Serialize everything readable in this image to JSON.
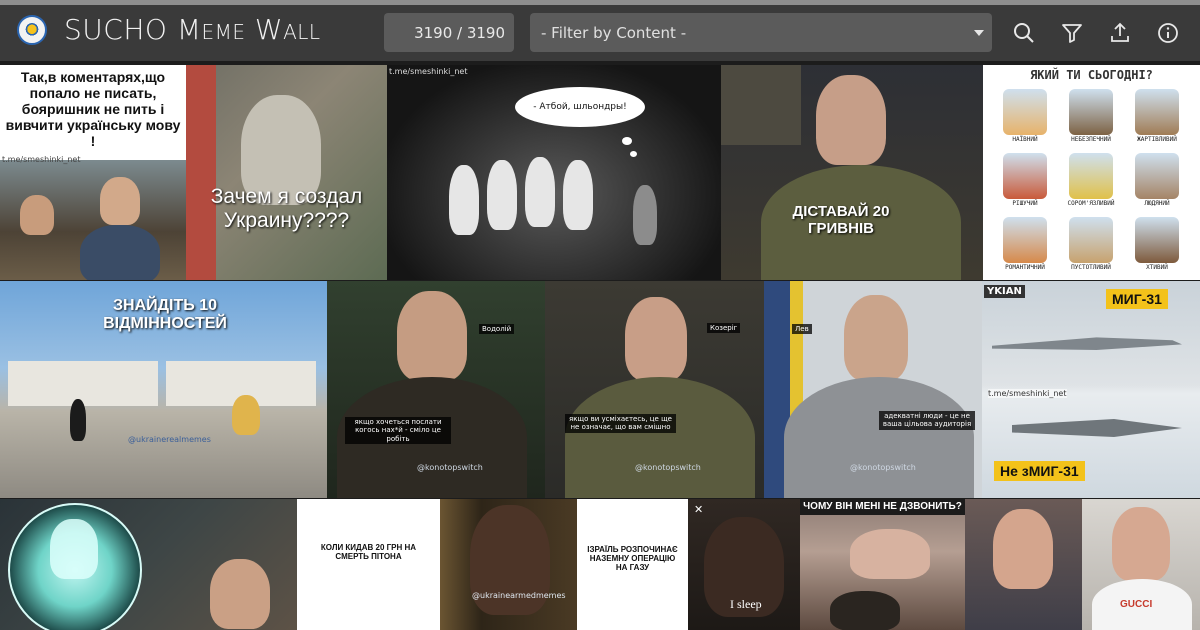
{
  "header": {
    "title_first": "SUCHO",
    "title_rest": "Meme Wall",
    "counter": "3190 / 3190",
    "filter_placeholder": "- Filter by Content -",
    "icons": [
      "search-icon",
      "filter-icon",
      "upload-icon",
      "info-icon"
    ]
  },
  "memes": {
    "m1": {
      "caption": "Так,в коментарях,що попало не писать, бояришник не пить і вивчити українську мову !",
      "watermark": "t.me/smeshinki_net"
    },
    "m2": {
      "caption": "Зачем я создал Украину????"
    },
    "m3": {
      "watermark": "t.me/smeshinki_net",
      "bubble": "- Атбой, шльондры!"
    },
    "m4": {
      "caption": "ДІСТАВАЙ 20 ГРИВНІВ"
    },
    "m5": {
      "title": "ЯКИЙ ТИ СЬОГОДНІ?",
      "labels": [
        "НАЇВНИЙ",
        "НЕБЕЗПЕЧНИЙ",
        "ЖАРТІВЛИВИЙ",
        "РІШУЧИЙ",
        "СОРОМ'ЯЗЛИВИЙ",
        "ЛЮДЯНИЙ",
        "РОМАНТИЧНИЙ",
        "ПУСТОТЛИВИЙ",
        "ХТИВИЙ"
      ]
    },
    "m6": {
      "caption": "ЗНАЙДІТЬ 10 ВІДМІННОСТЕЙ",
      "watermark": "@ukrainerealmemes"
    },
    "m7": {
      "sign": "Водолій",
      "text": "якщо хочеться послати когось нах*й - сміло це робіть",
      "watermark": "@konotopswitch"
    },
    "m8": {
      "sign": "Козеріг",
      "text": "якщо ви усміхаєтесь, це ще не означає, що вам смішно",
      "watermark": "@konotopswitch"
    },
    "m9": {
      "sign": "Лев",
      "text": "адекватні люди - це не ваша цільова аудиторія",
      "watermark": "@konotopswitch"
    },
    "m10": {
      "top": "МИГ-31",
      "bottom": "Не зМИГ-31",
      "logo": "ΥΚΙΑΝ",
      "watermark": "t.me/smeshinki_net"
    },
    "m12": {
      "caption": "КОЛИ КИДАВ 20 ГРН НА СМЕРТЬ ПІТОНА"
    },
    "m13": {
      "watermark": "@ukrainearmedmemes"
    },
    "m14": {
      "caption": "ІЗРАЇЛЬ РОЗПОЧИНАЄ НАЗЕМНУ ОПЕРАЦІЮ НА ГАЗУ"
    },
    "m15": {
      "caption": "I sleep",
      "close": "✕"
    },
    "m16": {
      "caption": "ЧОМУ ВІН МЕНІ НЕ ДЗВОНИТЬ?"
    },
    "m18": {
      "shirt": "GUCCI"
    }
  },
  "colors": {
    "header_bg": "#3a3a3a",
    "field_bg": "#5b5b5b",
    "page_bg": "#1c1c1c"
  }
}
